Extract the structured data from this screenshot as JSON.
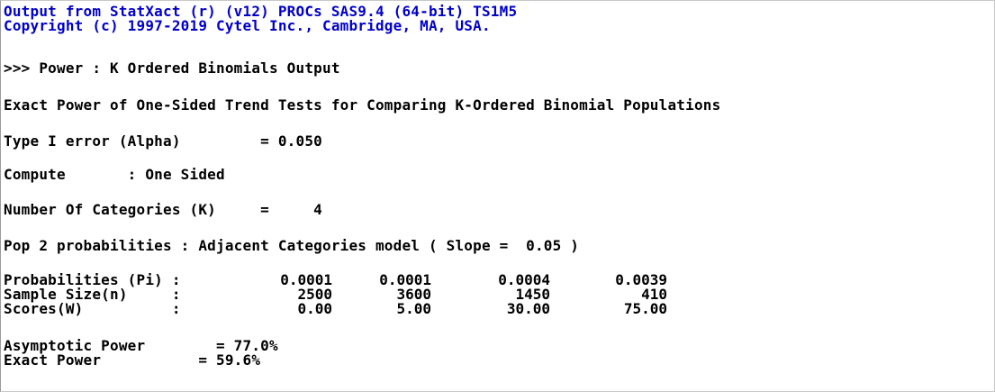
{
  "header": {
    "line1": "Output from StatXact (r) (v12) PROCs SAS9.4 (64-bit) TS1M5",
    "line2": "Copyright (c) 1997-2019 Cytel Inc., Cambridge, MA, USA."
  },
  "output": {
    "title": ">>> Power : K Ordered Binomials Output",
    "description": "Exact Power of One-Sided Trend Tests for Comparing K-Ordered Binomial Populations",
    "alpha": "Type I error (Alpha)         = 0.050",
    "compute": "Compute       : One Sided",
    "categories": "Number Of Categories (K)     =     4",
    "pop2": "Pop 2 probabilities : Adjacent Categories model ( Slope =  0.05 )",
    "rows": {
      "probabilities_label": "Probabilities (Pi) :",
      "sample_label": "Sample Size(n)     :",
      "scores_label": "Scores(W)          :"
    },
    "probabilities": [
      "0.0001",
      "0.0001",
      "0.0004",
      "0.0039"
    ],
    "sample_sizes": [
      "2500",
      "3600",
      "1450",
      "410"
    ],
    "scores": [
      "0.00",
      "5.00",
      "30.00",
      "75.00"
    ],
    "asymptotic_power": "Asymptotic Power        = 77.0%",
    "exact_power": "Exact Power           = 59.6%"
  }
}
